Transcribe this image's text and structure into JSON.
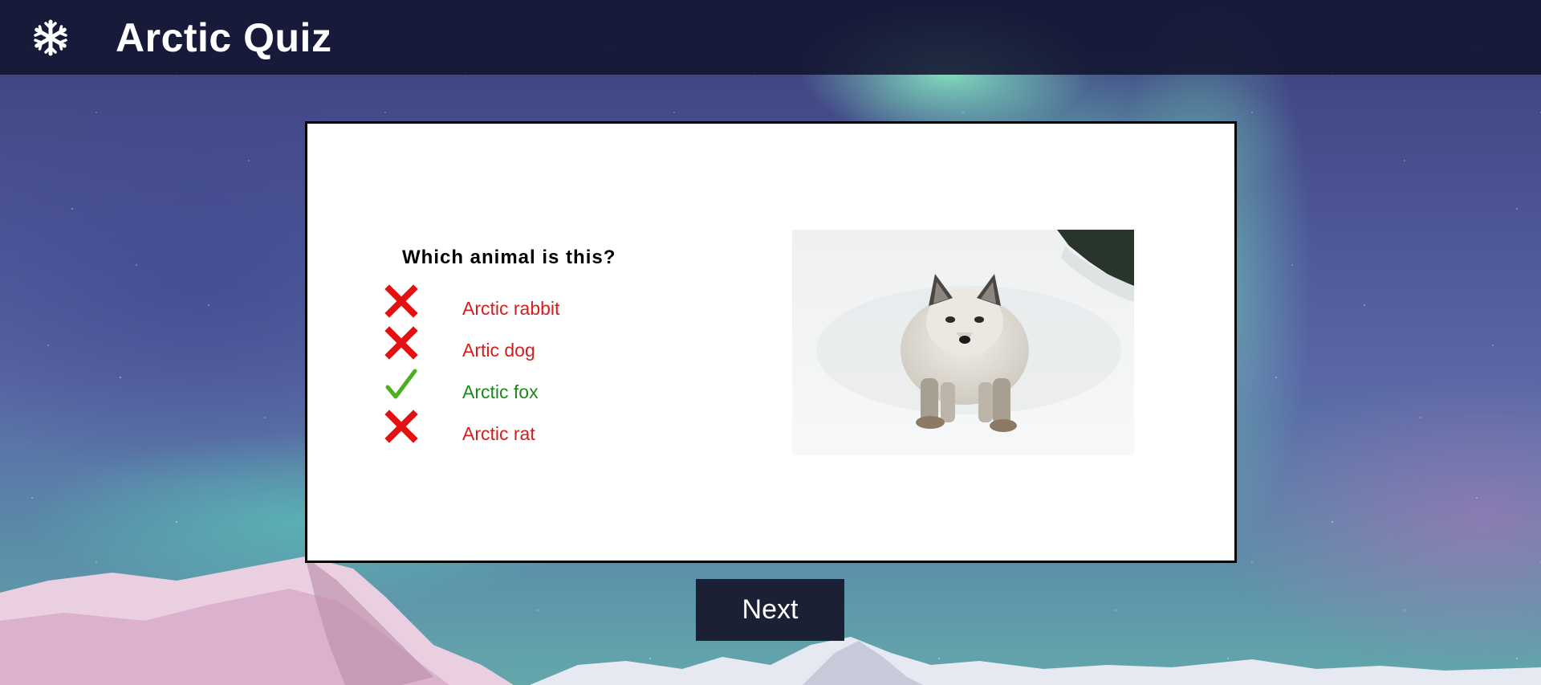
{
  "header": {
    "logo_icon": "snowflake-icon",
    "title": "Arctic Quiz"
  },
  "quiz": {
    "question": "Which animal is this?",
    "answers": [
      {
        "label": "Arctic rabbit",
        "status": "wrong",
        "icon": "cross-icon"
      },
      {
        "label": "Artic dog",
        "status": "wrong",
        "icon": "cross-icon"
      },
      {
        "label": "Arctic fox",
        "status": "correct",
        "icon": "checkmark-icon"
      },
      {
        "label": "Arctic rat",
        "status": "wrong",
        "icon": "cross-icon"
      }
    ],
    "image_subject": "arctic-fox-photo"
  },
  "footer": {
    "next_label": "Next"
  },
  "colors": {
    "header_bg": "#12142f",
    "wrong": "#d01f1f",
    "correct": "#1a8a1a",
    "cross_icon": "#e51010",
    "check_icon": "#4caf20",
    "button_bg": "#1c2035"
  }
}
